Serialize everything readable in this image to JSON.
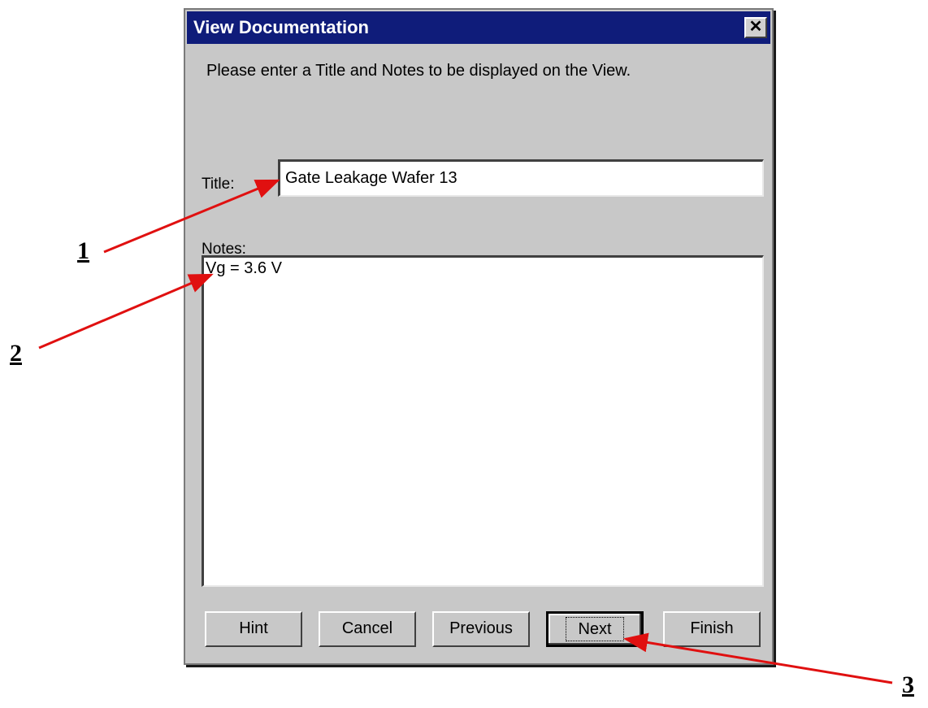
{
  "dialog": {
    "title": "View Documentation",
    "close_label": "✕",
    "instruction": "Please enter a Title and Notes to be displayed on the View.",
    "title_label": "Title:",
    "title_value": "Gate Leakage Wafer 13",
    "notes_label": "Notes:",
    "notes_value": "Vg = 3.6 V",
    "buttons": [
      {
        "label": "Hint"
      },
      {
        "label": "Cancel"
      },
      {
        "label": "Previous"
      },
      {
        "label": "Next"
      },
      {
        "label": "Finish"
      }
    ]
  },
  "callouts": [
    {
      "label": "1"
    },
    {
      "label": "2"
    },
    {
      "label": "3"
    }
  ],
  "colors": {
    "titlebar": "#0f1c7a",
    "dialog_bg": "#c8c8c8",
    "arrow": "#e01010"
  }
}
